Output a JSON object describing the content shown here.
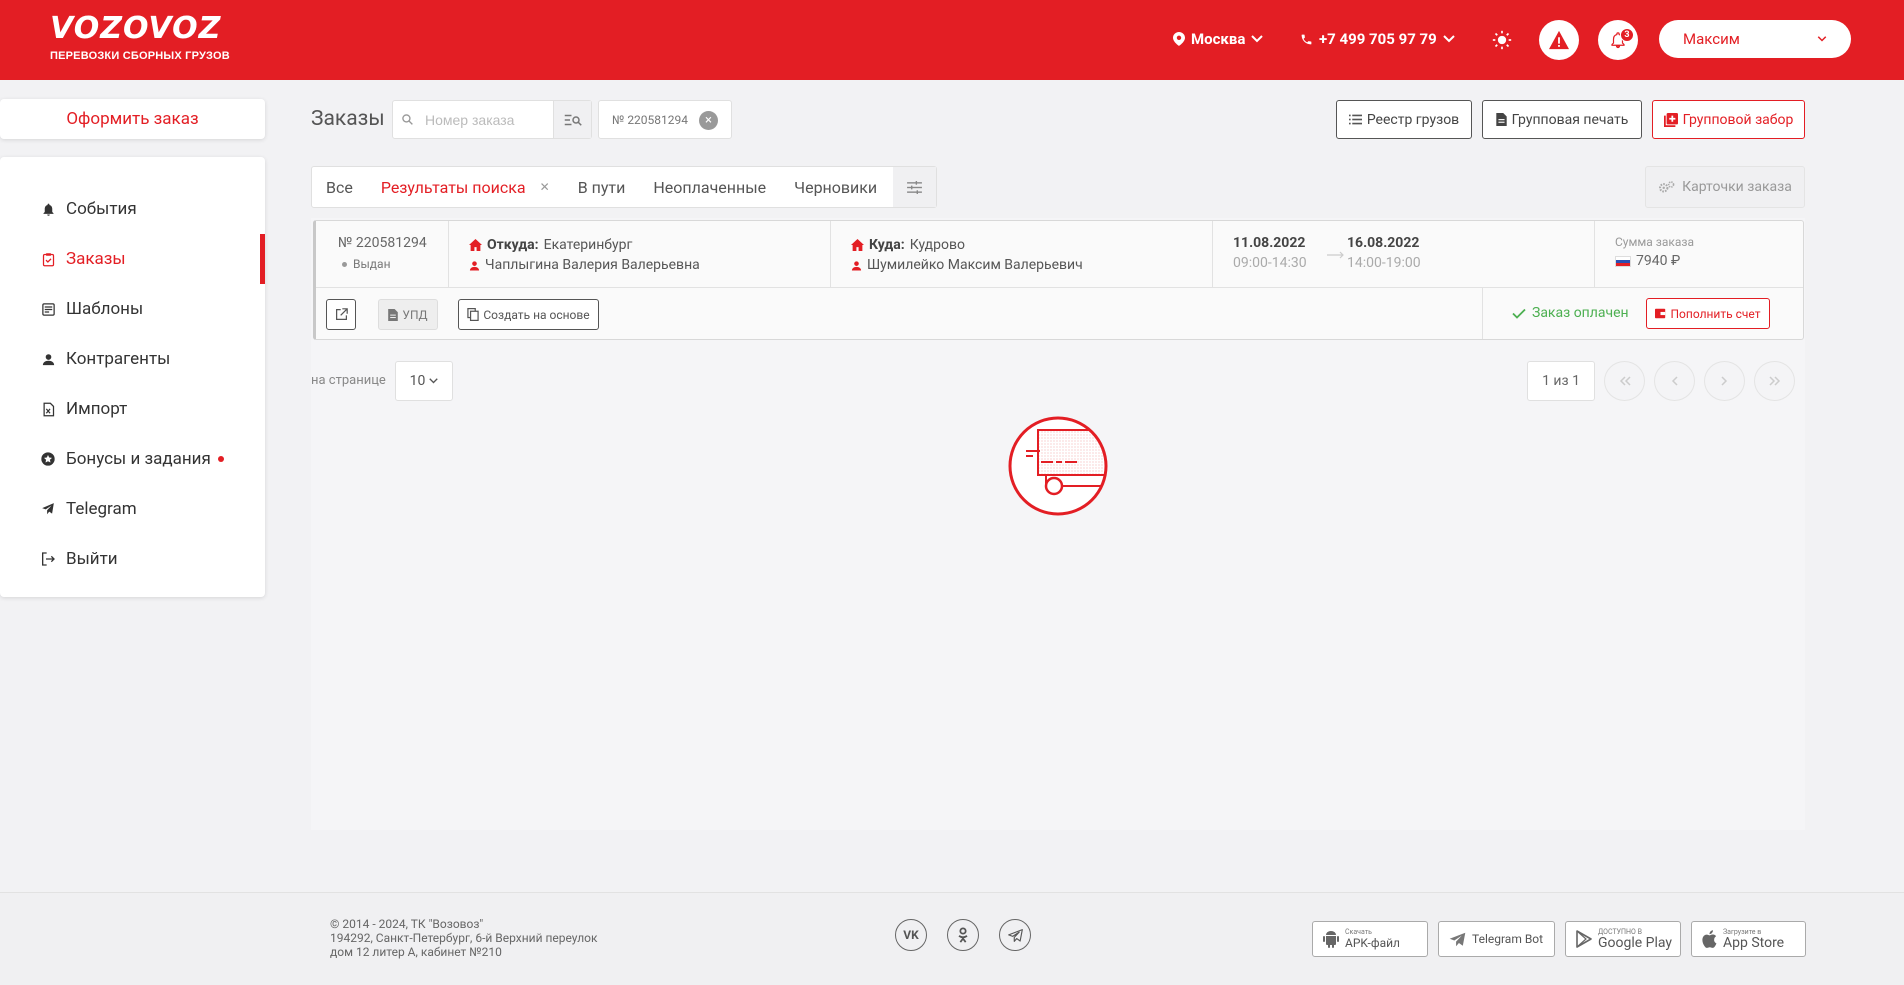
{
  "header": {
    "logo_main": "VOZOVOZ",
    "logo_sub": "ПЕРЕВОЗКИ СБОРНЫХ ГРУЗОВ",
    "city": "Москва",
    "phone": "+7 499 705 97 79",
    "notifications_count": "3",
    "user_name": "Максим",
    "brand_color": "#e31e24"
  },
  "sidebar": {
    "order_button": "Оформить заказ",
    "items": [
      {
        "label": "События",
        "icon": "bell-icon"
      },
      {
        "label": "Заказы",
        "icon": "clipboard-check-icon",
        "active": true
      },
      {
        "label": "Шаблоны",
        "icon": "template-icon"
      },
      {
        "label": "Контрагенты",
        "icon": "person-icon"
      },
      {
        "label": "Импорт",
        "icon": "excel-file-icon"
      },
      {
        "label": "Бонусы и задания",
        "icon": "star-badge-icon",
        "has_dot": true
      },
      {
        "label": "Telegram",
        "icon": "telegram-icon"
      },
      {
        "label": "Выйти",
        "icon": "logout-icon"
      }
    ]
  },
  "main": {
    "title": "Заказы",
    "search_placeholder": "Номер заказа",
    "search_chip": "№ 220581294",
    "buttons": {
      "registry": "Реестр грузов",
      "group_print": "Групповая печать",
      "group_pickup": "Групповой забор",
      "order_cards": "Карточки заказа"
    },
    "tabs": [
      {
        "label": "Все"
      },
      {
        "label": "Результаты поиска",
        "active": true,
        "closable": true
      },
      {
        "label": "В пути"
      },
      {
        "label": "Неоплаченные"
      },
      {
        "label": "Черновики"
      }
    ]
  },
  "order": {
    "number": "№ 220581294",
    "status": "Выдан",
    "from_label": "Откуда:",
    "from_city": "Екатеринбург",
    "from_person": "Чаплыгина Валерия Валерьевна",
    "to_label": "Куда:",
    "to_city": "Кудрово",
    "to_person": "Шумилейко Максим Валерьевич",
    "date_from": "11.08.2022",
    "time_from": "09:00-14:30",
    "date_to": "16.08.2022",
    "time_to": "14:00-19:00",
    "sum_label": "Сумма заказа",
    "sum_value": "7940 ₽",
    "upd_label": "УПД",
    "create_based_label": "Создать на основе",
    "paid_label": "Заказ оплачен",
    "topup_label": "Пополнить счет"
  },
  "pagination": {
    "per_page_label": "на странице",
    "per_page_value": "10",
    "page_info": "1 из 1"
  },
  "footer": {
    "copyright": "© 2014 - 2024, ТК \"Возовоз\"",
    "address_line1": "194292, Санкт-Петербург, 6-й Верхний переулок",
    "address_line2": "дом 12 литер А, кабинет №210",
    "stores": [
      {
        "small": "Скачать",
        "big": "APK-файл"
      },
      {
        "small": "",
        "big": "Telegram Bot"
      },
      {
        "small": "ДОСТУПНО В",
        "big": "Google Play"
      },
      {
        "small": "Загрузите в",
        "big": "App Store"
      }
    ]
  }
}
